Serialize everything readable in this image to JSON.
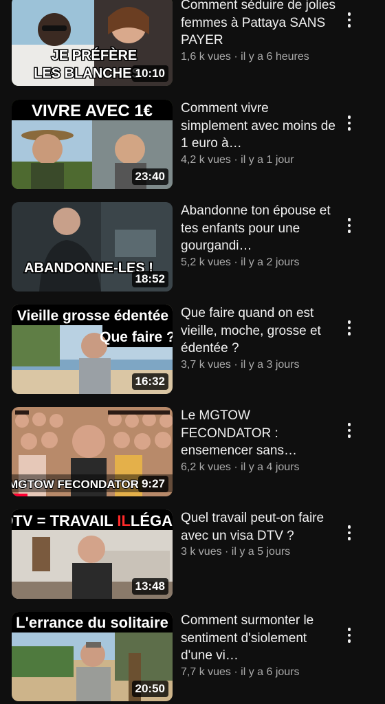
{
  "videos": [
    {
      "title": "Comment séduire de jolies femmes à Pattaya SANS PAYER",
      "meta": "1,6 k vues · il y a 6 heures",
      "duration": "10:10",
      "thumb_text": "JE PRÉFÈRE LES BLANCHES",
      "thumb_line1": "JE PRÉFÈRE",
      "thumb_line2": "LES BLANCHES"
    },
    {
      "title": "Comment vivre simplement avec moins de 1 euro à…",
      "meta": "4,2 k vues · il y a 1 jour",
      "duration": "23:40",
      "thumb_text": "VIVRE AVEC 1€"
    },
    {
      "title": "Abandonne ton épouse et tes enfants pour une gourgandi…",
      "meta": "5,2 k vues · il y a 2 jours",
      "duration": "18:52",
      "thumb_text": "ABANDONNE-LES !"
    },
    {
      "title": "Que faire quand on est vieille, moche, grosse et édentée ?",
      "meta": "3,7 k vues · il y a 3 jours",
      "duration": "16:32",
      "thumb_text": "Vieille grosse édentée",
      "thumb_text2": "Que faire ?"
    },
    {
      "title": "Le MGTOW FECONDATOR : ensemencer sans…",
      "meta": "6,2 k vues · il y a 4 jours",
      "duration": "9:27",
      "thumb_text": "MGTOW FECONDATOR",
      "watch_progress": 0.1
    },
    {
      "title": "Quel travail peut-on faire avec un visa DTV ?",
      "meta": "3 k vues · il y a 5 jours",
      "duration": "13:48",
      "thumb_text_a": "DTV = TRAVAIL ",
      "thumb_text_b": "IL",
      "thumb_text_c": "LÉGAL"
    },
    {
      "title": "Comment surmonter le sentiment d'siolement d'une vi…",
      "meta": "7,7 k vues · il y a 6 jours",
      "duration": "20:50",
      "thumb_text": "L'errance du solitaire"
    }
  ],
  "colors": {
    "background": "#0f0f0f",
    "title": "#f1f1f1",
    "meta": "#aaaaaa",
    "progress": "#ff0033"
  }
}
